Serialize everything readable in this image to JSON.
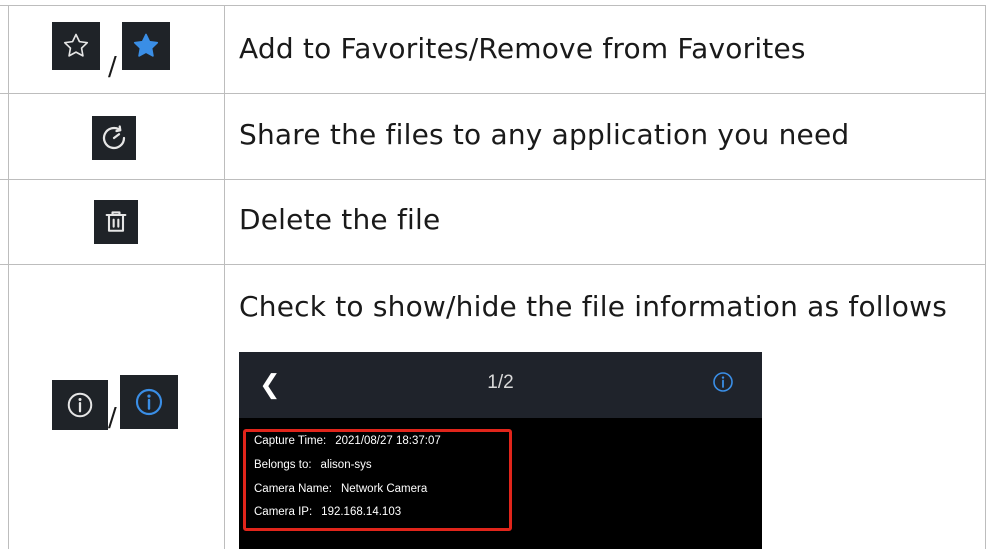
{
  "rows": [
    {
      "description": "Add to Favorites/Remove from Favorites",
      "icons": [
        "star-outline-icon",
        "star-filled-icon"
      ],
      "separator": "/"
    },
    {
      "description": "Share the files to any application you need",
      "icons": [
        "share-icon"
      ]
    },
    {
      "description": "Delete the file",
      "icons": [
        "trash-icon"
      ]
    },
    {
      "description": "Check to show/hide the file information as follows",
      "icons": [
        "info-icon",
        "info-active-icon"
      ],
      "separator": "/"
    }
  ],
  "preview": {
    "pager": "1/2",
    "back_glyph": "❮",
    "info": [
      {
        "label": "Capture Time:",
        "value": "2021/08/27 18:37:07"
      },
      {
        "label": "Belongs to:",
        "value": "alison-sys"
      },
      {
        "label": "Camera Name:",
        "value": "Network Camera"
      },
      {
        "label": "Camera IP:",
        "value": "192.168.14.103"
      }
    ]
  },
  "colors": {
    "icon_bg": "#1f2328",
    "accent_blue": "#3a8ee6",
    "highlight_red": "#e1251b"
  }
}
